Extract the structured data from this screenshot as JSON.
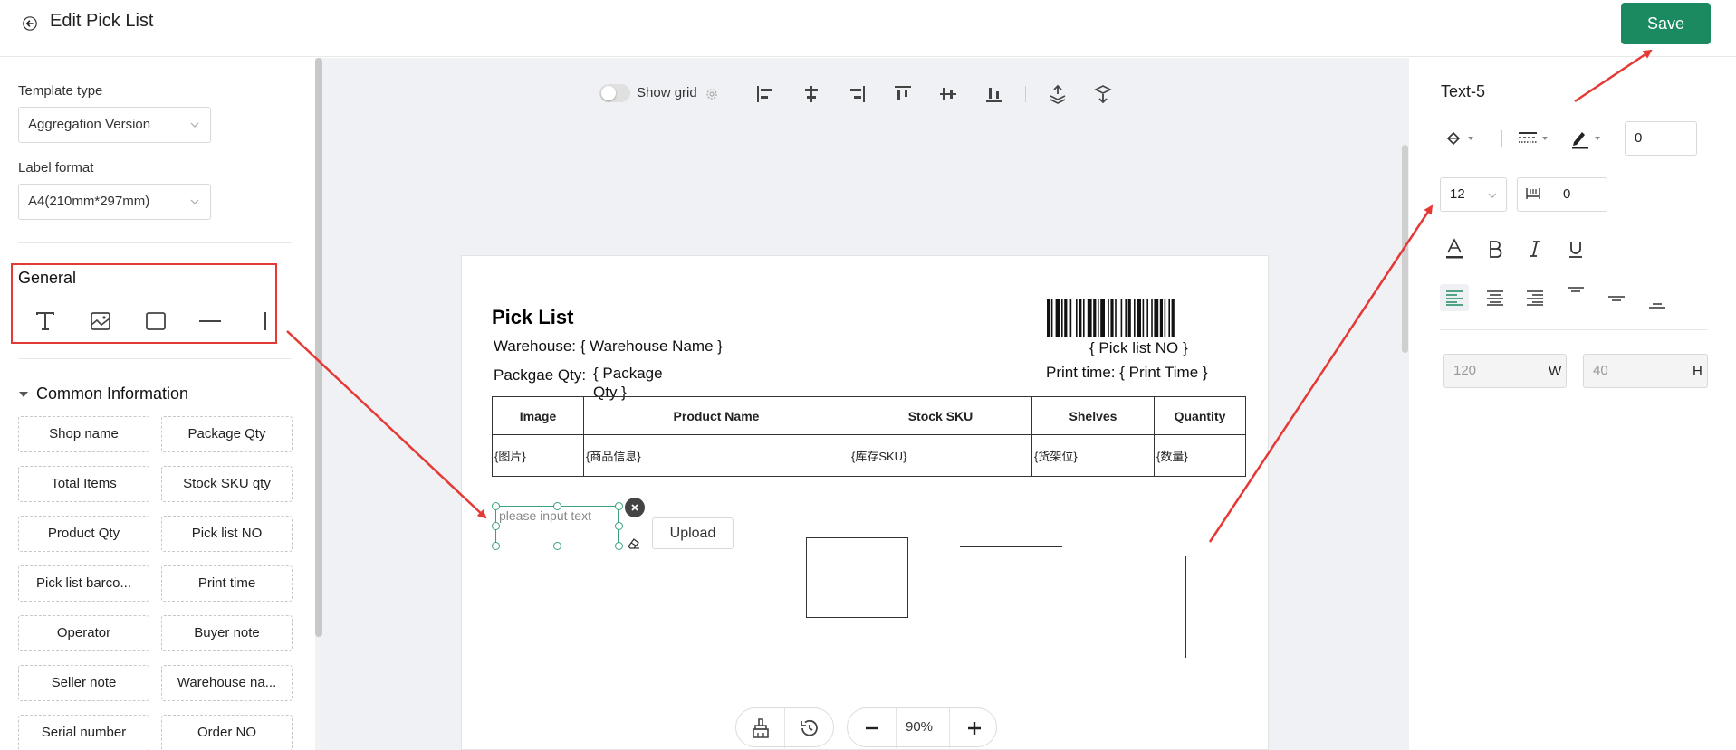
{
  "header": {
    "title": "Edit Pick List",
    "save_label": "Save"
  },
  "left": {
    "template_type_label": "Template type",
    "template_type_value": "Aggregation Version",
    "label_format_label": "Label format",
    "label_format_value": "A4(210mm*297mm)",
    "general_title": "General",
    "common_title": "Common Information",
    "chips": [
      "Shop name",
      "Package Qty",
      "Total Items",
      "Stock SKU qty",
      "Product Qty",
      "Pick list NO",
      "Pick list barco...",
      "Print time",
      "Operator",
      "Buyer note",
      "Seller note",
      "Warehouse na...",
      "Serial number",
      "Order NO"
    ]
  },
  "toolbar": {
    "show_grid_label": "Show grid"
  },
  "canvas": {
    "title": "Pick List",
    "warehouse": "Warehouse: { Warehouse Name }",
    "package_label": "Packgae Qty:",
    "package_value_1": "{ Package",
    "package_value_2": "Qty }",
    "pick_list_no": "{ Pick list NO }",
    "print_time": "Print time: { Print Time }",
    "table": {
      "headers": [
        "Image",
        "Product Name",
        "Stock SKU",
        "Shelves",
        "Quantity"
      ],
      "row": [
        "{图片}",
        "{商品信息}",
        "{库存SKU}",
        "{货架位}",
        "{数量}"
      ]
    },
    "text_placeholder": "please input text",
    "upload_label": "Upload",
    "zoom": "90%"
  },
  "right": {
    "element_name": "Text-5",
    "border_width": "0",
    "font_size": "12",
    "letter_spacing": "0",
    "width": "120",
    "width_suffix": "W",
    "height": "40",
    "height_suffix": "H"
  },
  "colors": {
    "accent": "#1c8a60",
    "highlight": "#e53935",
    "selection": "#3aa37a"
  }
}
